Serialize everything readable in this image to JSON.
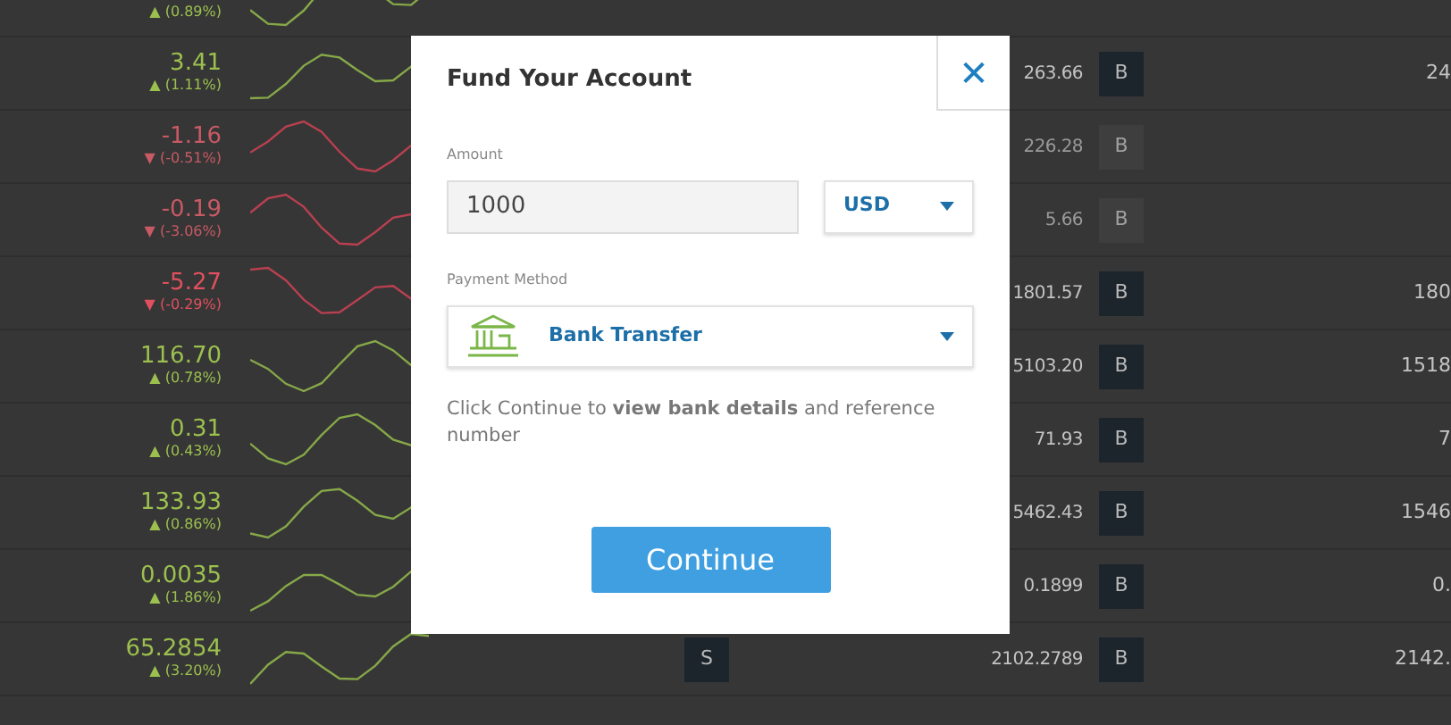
{
  "markets": [
    {
      "change_pct": "▲ (0.89%)",
      "falling": false,
      "disabled": false
    },
    {
      "change": "3.41",
      "change_pct": "▲ (1.11%)",
      "falling": false,
      "disabled": false,
      "sell": "263.66",
      "buy_button": "B",
      "buy": "24"
    },
    {
      "change": "-1.16",
      "change_pct": "▼ (-0.51%)",
      "falling": true,
      "disabled": true,
      "sell": "226.28",
      "buy_button": "B"
    },
    {
      "change": "-0.19",
      "change_pct": "▼ (-3.06%)",
      "falling": true,
      "disabled": true,
      "sell": "5.66",
      "buy_button": "B"
    },
    {
      "change": "-5.27",
      "change_pct": "▼ (-0.29%)",
      "falling": true,
      "disabled": false,
      "sell": "1801.57",
      "buy_button": "B",
      "buy": "180"
    },
    {
      "change": "116.70",
      "change_pct": "▲ (0.78%)",
      "falling": false,
      "disabled": false,
      "sell": "5103.20",
      "buy_button": "B",
      "buy": "1518"
    },
    {
      "change": "0.31",
      "change_pct": "▲ (0.43%)",
      "falling": false,
      "disabled": false,
      "sell": "71.93",
      "buy_button": "B",
      "buy": "7"
    },
    {
      "change": "133.93",
      "change_pct": "▲ (0.86%)",
      "falling": false,
      "disabled": false,
      "sell": "5462.43",
      "buy_button": "B",
      "buy": "1546"
    },
    {
      "change": "0.0035",
      "change_pct": "▲ (1.86%)",
      "falling": false,
      "disabled": false,
      "sell": "0.1899",
      "buy_button": "B",
      "buy": "0."
    },
    {
      "change": "65.2854",
      "change_pct": "▲ (3.20%)",
      "falling": false,
      "disabled": false,
      "trade_button": "S",
      "sell": "2102.2789",
      "buy_button": "B",
      "buy": "2142."
    }
  ],
  "dialog": {
    "title": "Fund Your Account",
    "close": "✕",
    "amount": {
      "label": "Amount",
      "value": "1000"
    },
    "currency": {
      "value": "USD"
    },
    "payment": {
      "label": "Payment Method",
      "value": "Bank Transfer"
    },
    "note": "Click Continue to **view bank details** and reference number",
    "continue": "Continue"
  }
}
